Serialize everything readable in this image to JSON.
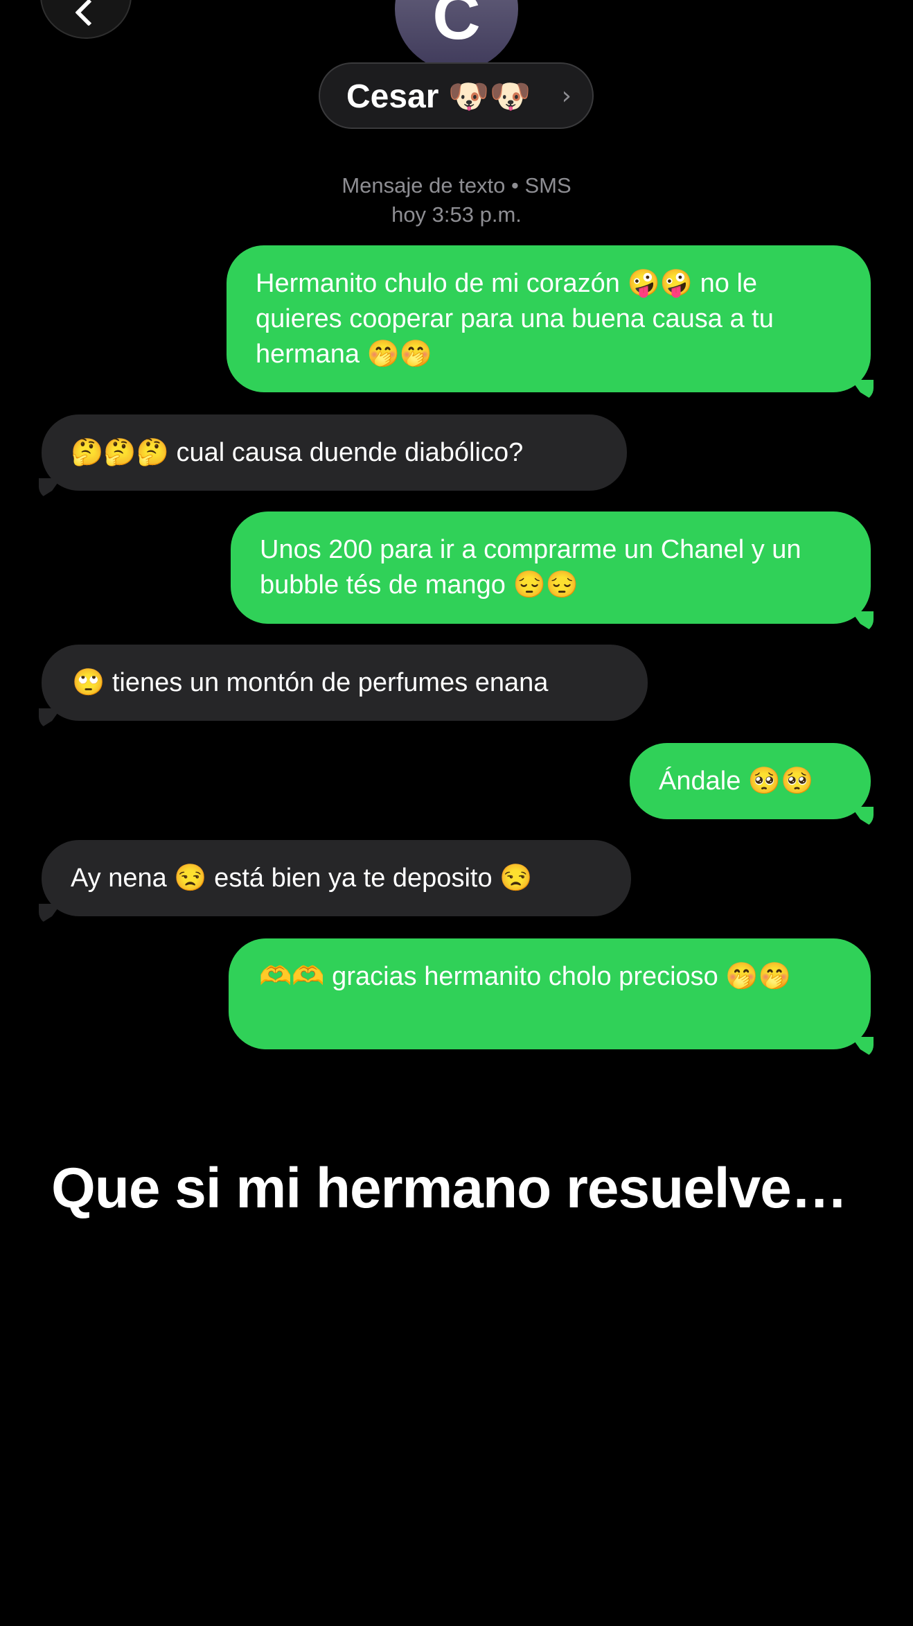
{
  "header": {
    "avatar_initial": "C",
    "contact_name": "Cesar 🐶🐶",
    "chevron": "›",
    "service_label": "Mensaje de texto • SMS",
    "timestamp": "hoy 3:53 p.m."
  },
  "messages": [
    {
      "direction": "sent",
      "text": "Hermanito chulo de mi corazón 🤪🤪 no le quieres cooperar para una buena causa a tu hermana 🤭🤭"
    },
    {
      "direction": "received",
      "text": "🤔🤔🤔 cual causa duende diabólico?"
    },
    {
      "direction": "sent",
      "text": "Unos 200 para ir a comprarme un Chanel y un bubble tés de mango 😔😔"
    },
    {
      "direction": "received",
      "text": "🙄 tienes un montón de perfumes enana"
    },
    {
      "direction": "sent",
      "text": "Ándale 🥺🥺"
    },
    {
      "direction": "received",
      "text": "Ay nena 😒 está bien ya te deposito 😒"
    },
    {
      "direction": "sent",
      "text": "🫶🫶 gracias hermanito cholo precioso 🤭🤭"
    }
  ],
  "caption": "Que si mi hermano resuelve…",
  "colors": {
    "sent_bubble": "#30d158",
    "received_bubble": "#262628",
    "background": "#000000",
    "meta_text": "#8e8e93"
  },
  "icons": {
    "back": "chevron-left-icon",
    "contact_disclosure": "chevron-right-icon"
  }
}
